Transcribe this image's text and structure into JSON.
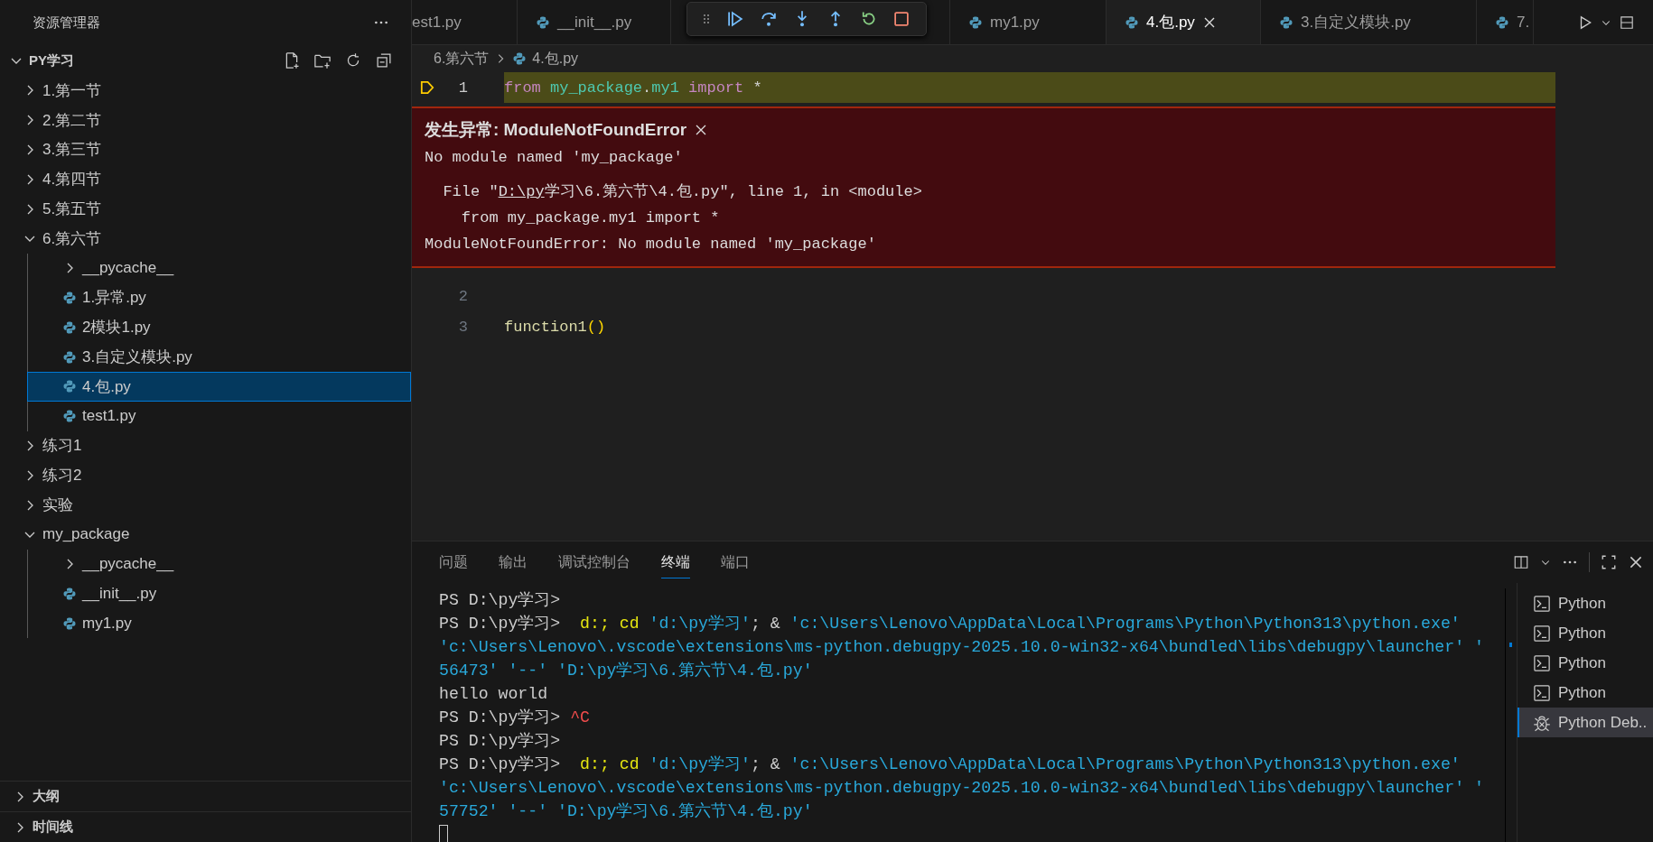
{
  "sidebar": {
    "title": "资源管理器",
    "root": {
      "label": "PY学习",
      "expanded": true
    },
    "tree": [
      {
        "label": "1.第一节",
        "kind": "folder",
        "expanded": false,
        "selected": false
      },
      {
        "label": "2.第二节",
        "kind": "folder",
        "expanded": false,
        "selected": false
      },
      {
        "label": "3.第三节",
        "kind": "folder",
        "expanded": false,
        "selected": false
      },
      {
        "label": "4.第四节",
        "kind": "folder",
        "expanded": false,
        "selected": false
      },
      {
        "label": "5.第五节",
        "kind": "folder",
        "expanded": false,
        "selected": false
      },
      {
        "label": "6.第六节",
        "kind": "folder",
        "expanded": true,
        "selected": false,
        "children": [
          {
            "label": "__pycache__",
            "kind": "folder",
            "expanded": false,
            "selected": false
          },
          {
            "label": "1.异常.py",
            "kind": "file",
            "selected": false
          },
          {
            "label": "2模块1.py",
            "kind": "file",
            "selected": false
          },
          {
            "label": "3.自定义模块.py",
            "kind": "file",
            "selected": false
          },
          {
            "label": "4.包.py",
            "kind": "file",
            "selected": true
          },
          {
            "label": "test1.py",
            "kind": "file",
            "selected": false
          }
        ]
      },
      {
        "label": "练习1",
        "kind": "folder",
        "expanded": false,
        "selected": false
      },
      {
        "label": "练习2",
        "kind": "folder",
        "expanded": false,
        "selected": false
      },
      {
        "label": "实验",
        "kind": "folder",
        "expanded": false,
        "selected": false
      },
      {
        "label": "my_package",
        "kind": "folder",
        "expanded": true,
        "selected": false,
        "children": [
          {
            "label": "__pycache__",
            "kind": "folder",
            "expanded": false,
            "selected": false
          },
          {
            "label": "__init__.py",
            "kind": "file",
            "selected": false
          },
          {
            "label": "my1.py",
            "kind": "file",
            "selected": false
          }
        ]
      }
    ],
    "sections": [
      {
        "label": "大纲",
        "expanded": false
      },
      {
        "label": "时间线",
        "expanded": false
      }
    ]
  },
  "tabs": [
    {
      "label": "est1.py",
      "selected": false
    },
    {
      "label": "__init__.py",
      "selected": false
    },
    {
      "label": "my1.py",
      "selected": false
    },
    {
      "label": "4.包.py",
      "selected": true
    },
    {
      "label": "3.自定义模块.py",
      "selected": false
    },
    {
      "label": "7.",
      "selected": false
    }
  ],
  "breadcrumb": [
    {
      "label": "6.第六节",
      "kind": "folder"
    },
    {
      "label": "4.包.py",
      "kind": "file"
    }
  ],
  "code": [
    {
      "number": "1",
      "current": true,
      "tokens": [
        {
          "text": "from ",
          "kind": "keyword"
        },
        {
          "text": "my_package",
          "kind": "module"
        },
        {
          "text": ".",
          "kind": "plain"
        },
        {
          "text": "my1 ",
          "kind": "module"
        },
        {
          "text": "import",
          "kind": "keyword"
        },
        {
          "text": " *",
          "kind": "plain"
        }
      ]
    },
    {
      "number": "2",
      "current": false
    },
    {
      "number": "3",
      "current": false,
      "tokens": [
        {
          "text": "function1",
          "kind": "function"
        },
        {
          "text": "()",
          "kind": "bracket"
        }
      ]
    }
  ],
  "exception": {
    "title": "发生异常: ModuleNotFoundError",
    "message": "No module named 'my_package'",
    "trace": [
      [
        {
          "text": "  File \"",
          "kind": "plain"
        },
        {
          "text": "D:\\py",
          "kind": "link"
        },
        {
          "text": "学习\\6.第六节\\4.包.py\", line 1, in <module>",
          "kind": "plain"
        }
      ],
      [
        {
          "text": "    from my_package.my1 import *",
          "kind": "plain"
        }
      ],
      [
        {
          "text": "ModuleNotFoundError: No module named 'my_package'",
          "kind": "plain"
        }
      ]
    ]
  },
  "panel": {
    "tabs": [
      {
        "label": "问题",
        "selected": false
      },
      {
        "label": "输出",
        "selected": false
      },
      {
        "label": "调试控制台",
        "selected": false
      },
      {
        "label": "终端",
        "selected": true
      },
      {
        "label": "端口",
        "selected": false
      }
    ],
    "terminal": [
      [
        {
          "text": "PS D:\\py学习>",
          "kind": "plain"
        }
      ],
      [
        {
          "text": "PS D:\\py学习>  ",
          "kind": "plain"
        },
        {
          "text": "d:; cd",
          "kind": "command"
        },
        {
          "text": " 'd:\\py学习'",
          "kind": "string"
        },
        {
          "text": "; & ",
          "kind": "plain"
        },
        {
          "text": "'c:\\Users\\Lenovo\\AppData\\Local\\Programs\\Python\\Python313\\python.exe'",
          "kind": "string"
        }
      ],
      [
        {
          "text": "'c:\\Users\\Lenovo\\.vscode\\extensions\\ms-python.debugpy-2025.10.0-win32-x64\\bundled\\libs\\debugpy\\launcher' '",
          "kind": "string"
        }
      ],
      [
        {
          "text": "56473' '--' 'D:\\py学习\\6.第六节\\4.包.py'",
          "kind": "string"
        }
      ],
      [
        {
          "text": "hello world",
          "kind": "plain"
        }
      ],
      [
        {
          "text": "PS D:\\py学习> ",
          "kind": "plain"
        },
        {
          "text": "^C",
          "kind": "error"
        }
      ],
      [
        {
          "text": "PS D:\\py学习>",
          "kind": "plain"
        }
      ],
      [
        {
          "text": "PS D:\\py学习>  ",
          "kind": "plain"
        },
        {
          "text": "d:; cd",
          "kind": "command"
        },
        {
          "text": " 'd:\\py学习'",
          "kind": "string"
        },
        {
          "text": "; & ",
          "kind": "plain"
        },
        {
          "text": "'c:\\Users\\Lenovo\\AppData\\Local\\Programs\\Python\\Python313\\python.exe'",
          "kind": "string"
        }
      ],
      [
        {
          "text": "'c:\\Users\\Lenovo\\.vscode\\extensions\\ms-python.debugpy-2025.10.0-win32-x64\\bundled\\libs\\debugpy\\launcher' '",
          "kind": "string"
        }
      ],
      [
        {
          "text": "57752' '--' 'D:\\py学习\\6.第六节\\4.包.py'",
          "kind": "string"
        }
      ]
    ],
    "sessions": [
      {
        "label": "Python",
        "kind": "shell",
        "selected": false
      },
      {
        "label": "Python",
        "kind": "shell",
        "selected": false
      },
      {
        "label": "Python",
        "kind": "shell",
        "selected": false
      },
      {
        "label": "Python",
        "kind": "shell",
        "selected": false
      },
      {
        "label": "Python Deb..",
        "kind": "debug",
        "selected": true
      }
    ]
  }
}
